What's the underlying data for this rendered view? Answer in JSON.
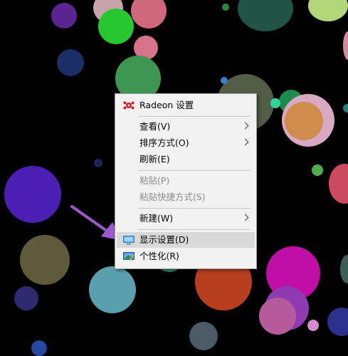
{
  "desktop": {
    "wallpaper_colors": [
      "#000000",
      "#4c1fb4",
      "#5e5a3a",
      "#5a9fae",
      "#c10ea6",
      "#8f3ab0",
      "#b83e1f",
      "#3fa35a",
      "#cb4a5f"
    ]
  },
  "context_menu": {
    "items": [
      {
        "label": "Radeon 设置",
        "icon": "radeon-icon",
        "disabled": false,
        "submenu": false
      },
      {
        "label": "查看(V)",
        "disabled": false,
        "submenu": true
      },
      {
        "label": "排序方式(O)",
        "disabled": false,
        "submenu": true
      },
      {
        "label": "刷新(E)",
        "disabled": false,
        "submenu": false
      },
      {
        "label": "粘贴(P)",
        "disabled": true,
        "submenu": false
      },
      {
        "label": "粘贴快捷方式(S)",
        "disabled": true,
        "submenu": false
      },
      {
        "label": "新建(W)",
        "disabled": false,
        "submenu": true
      },
      {
        "label": "显示设置(D)",
        "icon": "display-settings-icon",
        "disabled": false,
        "submenu": false,
        "highlighted": true
      },
      {
        "label": "个性化(R)",
        "icon": "personalize-icon",
        "disabled": false,
        "submenu": false
      }
    ],
    "highlight_color": "#d9d9d9",
    "background_color": "#f2f2f2"
  },
  "annotation": {
    "arrow_icon": "purple-pointer-arrow-icon",
    "arrow_color": "#9b59d0"
  }
}
